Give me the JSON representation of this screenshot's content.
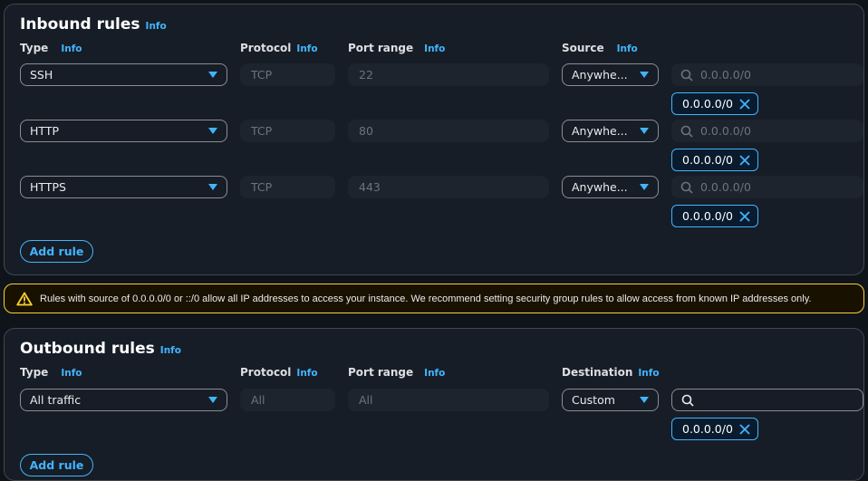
{
  "inbound": {
    "title": "Inbound rules",
    "info": "Info",
    "headers": {
      "type": "Type",
      "protocol": "Protocol",
      "port_range": "Port range",
      "source": "Source"
    },
    "rules": [
      {
        "type": "SSH",
        "protocol": "TCP",
        "port": "22",
        "source": "Anywhe...",
        "search_placeholder": "0.0.0.0/0",
        "chip": "0.0.0.0/0"
      },
      {
        "type": "HTTP",
        "protocol": "TCP",
        "port": "80",
        "source": "Anywhe...",
        "search_placeholder": "0.0.0.0/0",
        "chip": "0.0.0.0/0"
      },
      {
        "type": "HTTPS",
        "protocol": "TCP",
        "port": "443",
        "source": "Anywhe...",
        "search_placeholder": "0.0.0.0/0",
        "chip": "0.0.0.0/0"
      }
    ],
    "add_rule": "Add rule"
  },
  "warning": {
    "icon": "warning-triangle-icon",
    "text": "Rules with source of 0.0.0.0/0 or ::/0 allow all IP addresses to access your instance. We recommend setting security group rules to allow access from known IP addresses only."
  },
  "outbound": {
    "title": "Outbound rules",
    "info": "Info",
    "headers": {
      "type": "Type",
      "protocol": "Protocol",
      "port_range": "Port range",
      "destination": "Destination"
    },
    "rules": [
      {
        "type": "All traffic",
        "protocol": "All",
        "port": "All",
        "destination": "Custom",
        "search_value": "",
        "chip": "0.0.0.0/0"
      }
    ],
    "add_rule": "Add rule"
  },
  "colors": {
    "accent": "#42b4ff",
    "warning": "#fbd332"
  }
}
